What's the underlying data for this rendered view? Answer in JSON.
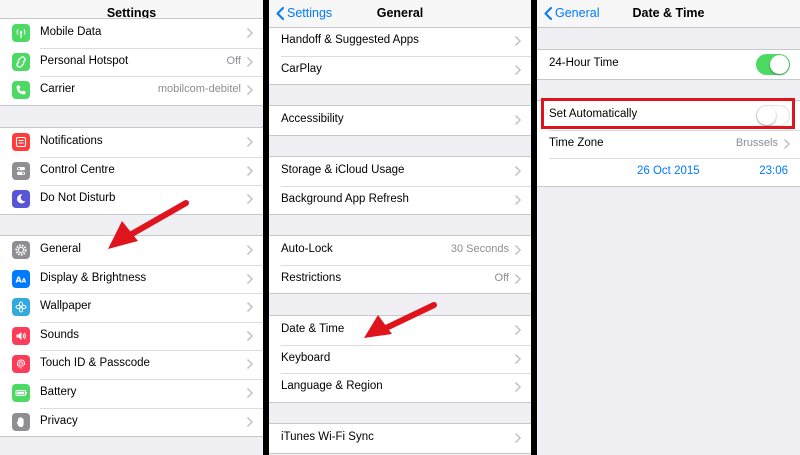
{
  "colors": {
    "accent": "#007aff",
    "switch_on": "#4cd964",
    "highlight": "#e0141c",
    "arrow": "#e0141c"
  },
  "settings": {
    "title": "Settings",
    "group_connect": [
      {
        "label": "Mobile Data",
        "value": "",
        "icon": "antenna-icon",
        "color": "#4cd964"
      },
      {
        "label": "Personal Hotspot",
        "value": "Off",
        "icon": "hotspot-icon",
        "color": "#4cd964"
      },
      {
        "label": "Carrier",
        "value": "mobilcom-debitel",
        "icon": "phone-icon",
        "color": "#4cd964"
      }
    ],
    "group_notify": [
      {
        "label": "Notifications",
        "icon": "notifications-icon",
        "color": "#fc3d39"
      },
      {
        "label": "Control Centre",
        "icon": "switches-icon",
        "color": "#8e8e93"
      },
      {
        "label": "Do Not Disturb",
        "icon": "moon-icon",
        "color": "#5856d6"
      }
    ],
    "group_general": [
      {
        "label": "General",
        "icon": "gear-icon",
        "color": "#8e8e93"
      },
      {
        "label": "Display & Brightness",
        "icon": "text-size-icon",
        "color": "#007aff"
      },
      {
        "label": "Wallpaper",
        "icon": "flower-icon",
        "color": "#34aadc"
      },
      {
        "label": "Sounds",
        "icon": "speaker-icon",
        "color": "#fc3d59"
      },
      {
        "label": "Touch ID & Passcode",
        "icon": "fingerprint-icon",
        "color": "#fc3d59"
      },
      {
        "label": "Battery",
        "icon": "battery-icon",
        "color": "#4cd964"
      },
      {
        "label": "Privacy",
        "icon": "hand-icon",
        "color": "#8e8e93"
      }
    ]
  },
  "general": {
    "back_label": "Settings",
    "title": "General",
    "group_a": [
      {
        "label": "Handoff & Suggested Apps"
      },
      {
        "label": "CarPlay"
      }
    ],
    "group_b": [
      {
        "label": "Accessibility"
      }
    ],
    "group_c": [
      {
        "label": "Storage & iCloud Usage"
      },
      {
        "label": "Background App Refresh"
      }
    ],
    "group_d": [
      {
        "label": "Auto-Lock",
        "value": "30 Seconds"
      },
      {
        "label": "Restrictions",
        "value": "Off"
      }
    ],
    "group_e": [
      {
        "label": "Date & Time"
      },
      {
        "label": "Keyboard"
      },
      {
        "label": "Language & Region"
      }
    ],
    "group_f": [
      {
        "label": "iTunes Wi-Fi Sync"
      }
    ]
  },
  "datetime": {
    "back_label": "General",
    "title": "Date & Time",
    "hour24_label": "24-Hour Time",
    "hour24_on": true,
    "set_auto_label": "Set Automatically",
    "set_auto_on": false,
    "timezone_label": "Time Zone",
    "timezone_value": "Brussels",
    "date": "26 Oct 2015",
    "time": "23:06"
  }
}
